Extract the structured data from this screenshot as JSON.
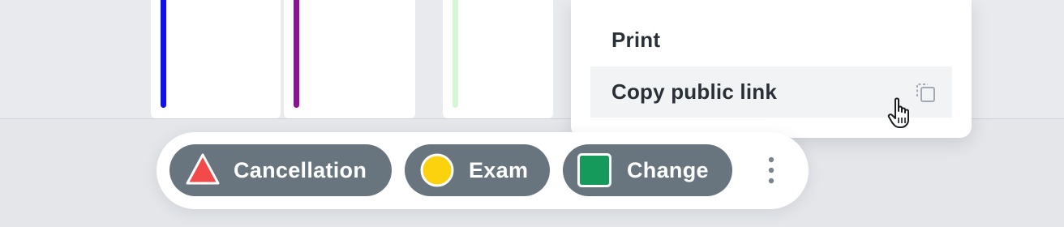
{
  "calendar": {
    "columns": [
      {
        "stripe_color": "#1010ee"
      },
      {
        "stripe_color": "#8a1590"
      },
      {
        "stripe_color": "#d6f7d3"
      }
    ]
  },
  "menu": {
    "items": [
      {
        "label": "Print"
      },
      {
        "label": "Copy public link",
        "icon": "copy-icon"
      }
    ]
  },
  "legend": {
    "chips": [
      {
        "label": "Cancellation",
        "icon": "triangle-icon",
        "icon_color": "#f24a4a"
      },
      {
        "label": "Exam",
        "icon": "circle-icon",
        "icon_color": "#fcd20f"
      },
      {
        "label": "Change",
        "icon": "square-icon",
        "icon_color": "#169a5b"
      }
    ],
    "more_icon": "kebab-menu-icon"
  },
  "colors": {
    "chip_bg": "#68747e",
    "menu_highlight": "#f2f3f5",
    "text": "#2a3037"
  }
}
